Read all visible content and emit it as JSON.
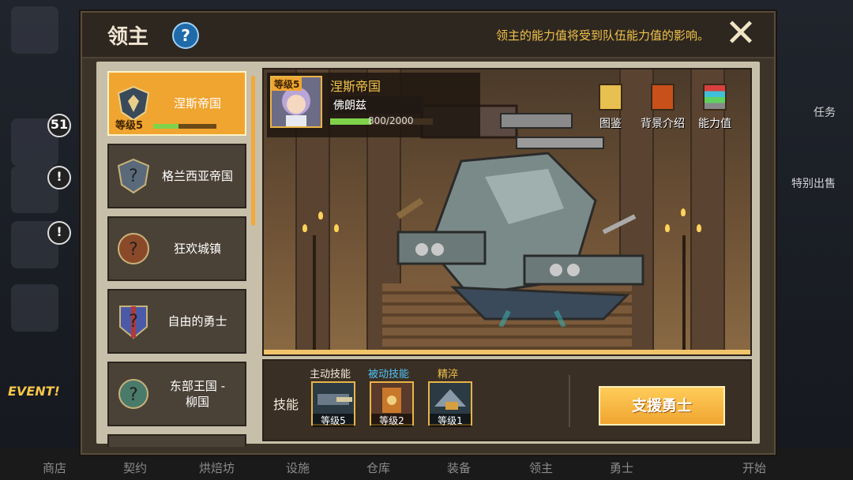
{
  "background": {
    "badges": [
      "51",
      "!",
      "!"
    ],
    "event_label": "EVENT!",
    "right_labels": [
      "任务",
      "特别出售"
    ],
    "bottom_nav": [
      "商店",
      "契约",
      "烘焙坊",
      "设施",
      "仓库",
      "装备",
      "领主",
      "勇士",
      "开始"
    ]
  },
  "modal": {
    "title": "领主",
    "help": "?",
    "note": "领主的能力值将受到队伍能力值的影响。",
    "close": "✕"
  },
  "lords": [
    {
      "name": "涅斯帝国",
      "level": "等级5",
      "progress": 0.4,
      "active": true
    },
    {
      "name": "格兰西亚帝国",
      "active": false
    },
    {
      "name": "狂欢城镇",
      "active": false
    },
    {
      "name": "自由的勇士",
      "active": false
    },
    {
      "name": "东部王国 -\n柳国",
      "active": false
    }
  ],
  "hero": {
    "level": "等级5",
    "faction": "涅斯帝国",
    "name": "佛朗兹",
    "xp_text": "800/2000",
    "xp_fraction": 0.4
  },
  "stage_buttons": [
    {
      "label": "图鉴",
      "icon": "book-icon"
    },
    {
      "label": "背景介绍",
      "icon": "scroll-icon"
    },
    {
      "label": "能力值",
      "icon": "stats-icon"
    }
  ],
  "skills": {
    "label": "技能",
    "headers": {
      "active": "主动技能",
      "passive": "被动技能",
      "essence": "精淬"
    },
    "items": [
      {
        "level": "等级5"
      },
      {
        "level": "等级2"
      },
      {
        "level": "等级1"
      }
    ],
    "support_button": "支援勇士"
  },
  "colors": {
    "accent": "#f0a531",
    "passive": "#4fc3f7",
    "note": "#f0c24a"
  }
}
